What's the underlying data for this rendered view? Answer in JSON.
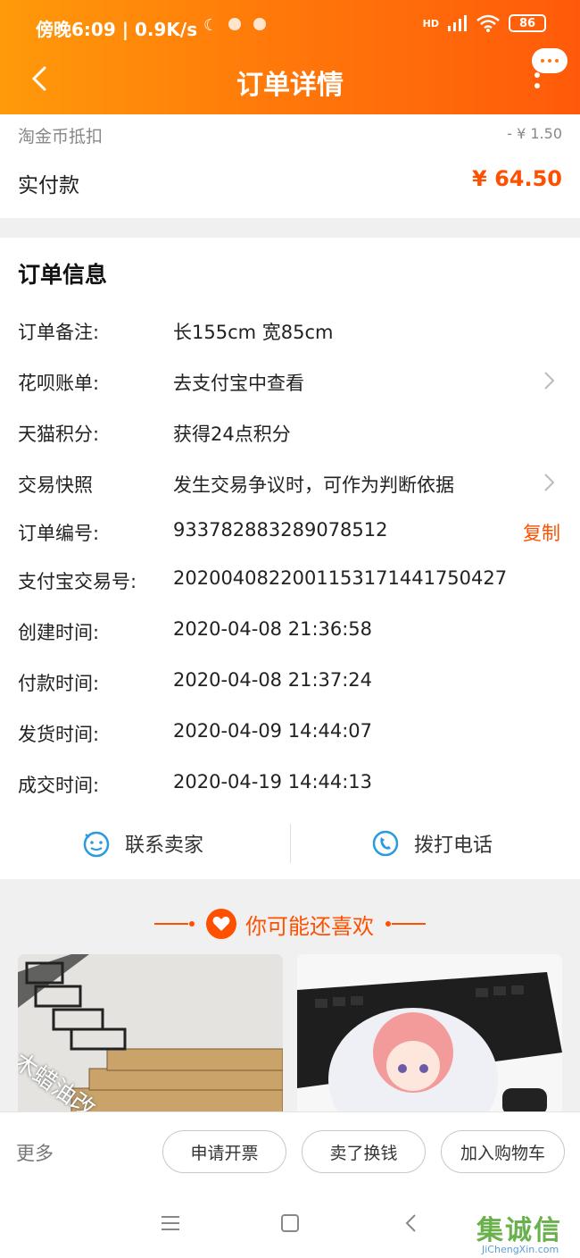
{
  "status_bar": {
    "time": "傍晚6:09 | 0.9K/s",
    "network": "HD",
    "battery": "86"
  },
  "header": {
    "title": "订单详情"
  },
  "payment": {
    "taojin_label": "淘金币抵扣",
    "taojin_value": "- ¥ 1.50",
    "paid_label": "实付款",
    "paid_value": "¥ 64.50"
  },
  "order_info": {
    "title": "订单信息",
    "rows": [
      {
        "label": "订单备注:",
        "value": "长155cm 宽85cm"
      },
      {
        "label": "花呗账单:",
        "value": "去支付宝中查看"
      },
      {
        "label": "天猫积分:",
        "value": "获得24点积分"
      },
      {
        "label": "交易快照",
        "value": "发生交易争议时，可作为判断依据"
      },
      {
        "label": "订单编号:",
        "value": "933782883289078512"
      },
      {
        "label": "支付宝交易号:",
        "value": "2020040822001153171441750427"
      },
      {
        "label": "创建时间:",
        "value": "2020-04-08 21:36:58"
      },
      {
        "label": "付款时间:",
        "value": "2020-04-08 21:37:24"
      },
      {
        "label": "发货时间:",
        "value": "2020-04-09 14:44:07"
      },
      {
        "label": "成交时间:",
        "value": "2020-04-19 14:44:13"
      }
    ],
    "copy_label": "复制"
  },
  "contact": {
    "seller_label": "联系卖家",
    "phone_label": "拨打电话"
  },
  "recommend": {
    "title": "你可能还喜欢",
    "product_1_overlay": "木蜡油改"
  },
  "actions": {
    "more_label": "更多",
    "invoice_label": "申请开票",
    "resell_label": "卖了换钱",
    "cart_label": "加入购物车"
  },
  "watermark": {
    "main": "集诚信",
    "sub": "JiChengXin.com"
  },
  "colors": {
    "accent": "#ff5000",
    "header_start": "#ff9a0a",
    "header_end": "#ff5a0a",
    "icon_blue": "#2b9ae0"
  }
}
